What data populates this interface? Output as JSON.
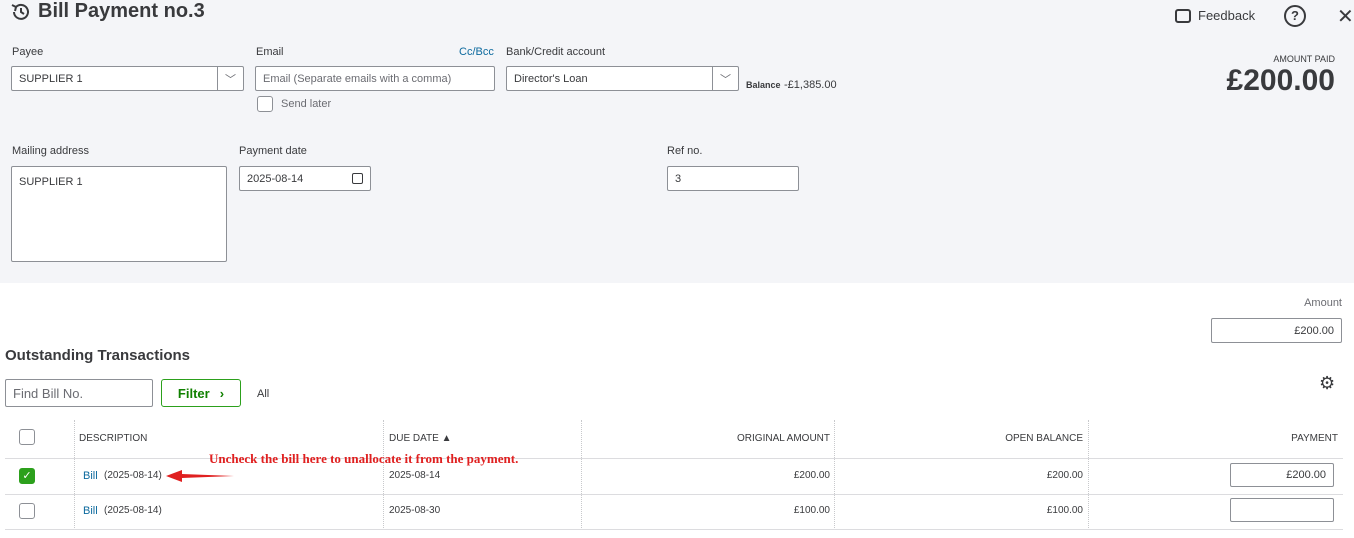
{
  "header": {
    "title": "Bill Payment no.3",
    "feedback": "Feedback",
    "help": "?",
    "close": "✕"
  },
  "form": {
    "payee_label": "Payee",
    "payee_value": "SUPPLIER 1",
    "email_label": "Email",
    "cc_bcc": "Cc/Bcc",
    "email_placeholder": "Email (Separate emails with a comma)",
    "send_later": "Send later",
    "bank_label": "Bank/Credit account",
    "bank_value": "Director's Loan",
    "balance_label": "Balance",
    "balance_value": "-£1,385.00",
    "amount_paid_label": "AMOUNT PAID",
    "amount_paid_value": "£200.00",
    "mailing_label": "Mailing address",
    "mailing_value": "SUPPLIER 1",
    "date_label": "Payment date",
    "date_value": "2025-08-14",
    "ref_label": "Ref no.",
    "ref_value": "3",
    "amount_label": "Amount",
    "amount_value": "£200.00"
  },
  "outstanding": {
    "title": "Outstanding Transactions",
    "find_placeholder": "Find Bill No.",
    "filter": "Filter",
    "all": "All",
    "columns": [
      "DESCRIPTION",
      "DUE DATE ▲",
      "ORIGINAL AMOUNT",
      "OPEN BALANCE",
      "PAYMENT"
    ],
    "rows": [
      {
        "checked": true,
        "link": "Bill",
        "desc": "(2025-08-14)",
        "due": "2025-08-14",
        "original": "£200.00",
        "open": "£200.00",
        "payment": "£200.00"
      },
      {
        "checked": false,
        "link": "Bill",
        "desc": "(2025-08-14)",
        "due": "2025-08-30",
        "original": "£100.00",
        "open": "£100.00",
        "payment": ""
      }
    ]
  },
  "annotation": {
    "text": "Uncheck  the bill here to unallocate it from the payment.",
    "color": "#e02020"
  }
}
